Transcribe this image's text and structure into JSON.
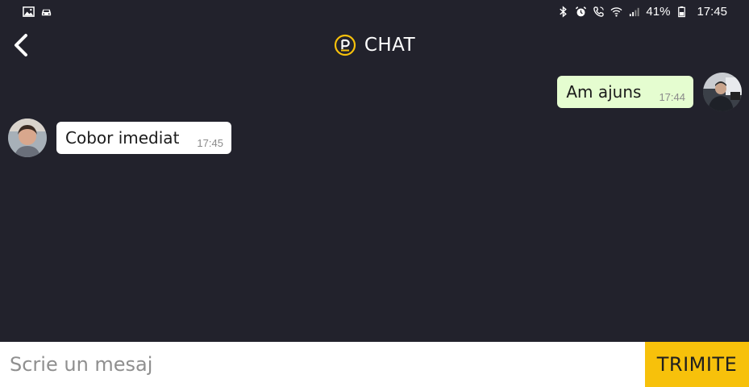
{
  "status_bar": {
    "left_icons": [
      "gallery-icon",
      "car-icon"
    ],
    "right_icons": [
      "bluetooth-icon",
      "alarm-icon",
      "call-icon",
      "wifi-icon",
      "signal-icon",
      "battery-icon"
    ],
    "battery": "41%",
    "time": "17:45"
  },
  "header": {
    "title": "CHAT",
    "logo_icon": "app-logo-icon",
    "back_icon": "chevron-left-icon"
  },
  "messages": [
    {
      "direction": "outgoing",
      "text": "Am ajuns",
      "time": "17:44",
      "avatar": "driver-avatar"
    },
    {
      "direction": "incoming",
      "text": "Cobor imediat",
      "time": "17:45",
      "avatar": "passenger-avatar"
    }
  ],
  "composer": {
    "placeholder": "Scrie un mesaj",
    "value": "",
    "send_label": "TRIMITE"
  },
  "colors": {
    "background": "#22222c",
    "outgoing_bubble": "#e5fdd0",
    "incoming_bubble": "#ffffff",
    "accent": "#f7c10b"
  }
}
